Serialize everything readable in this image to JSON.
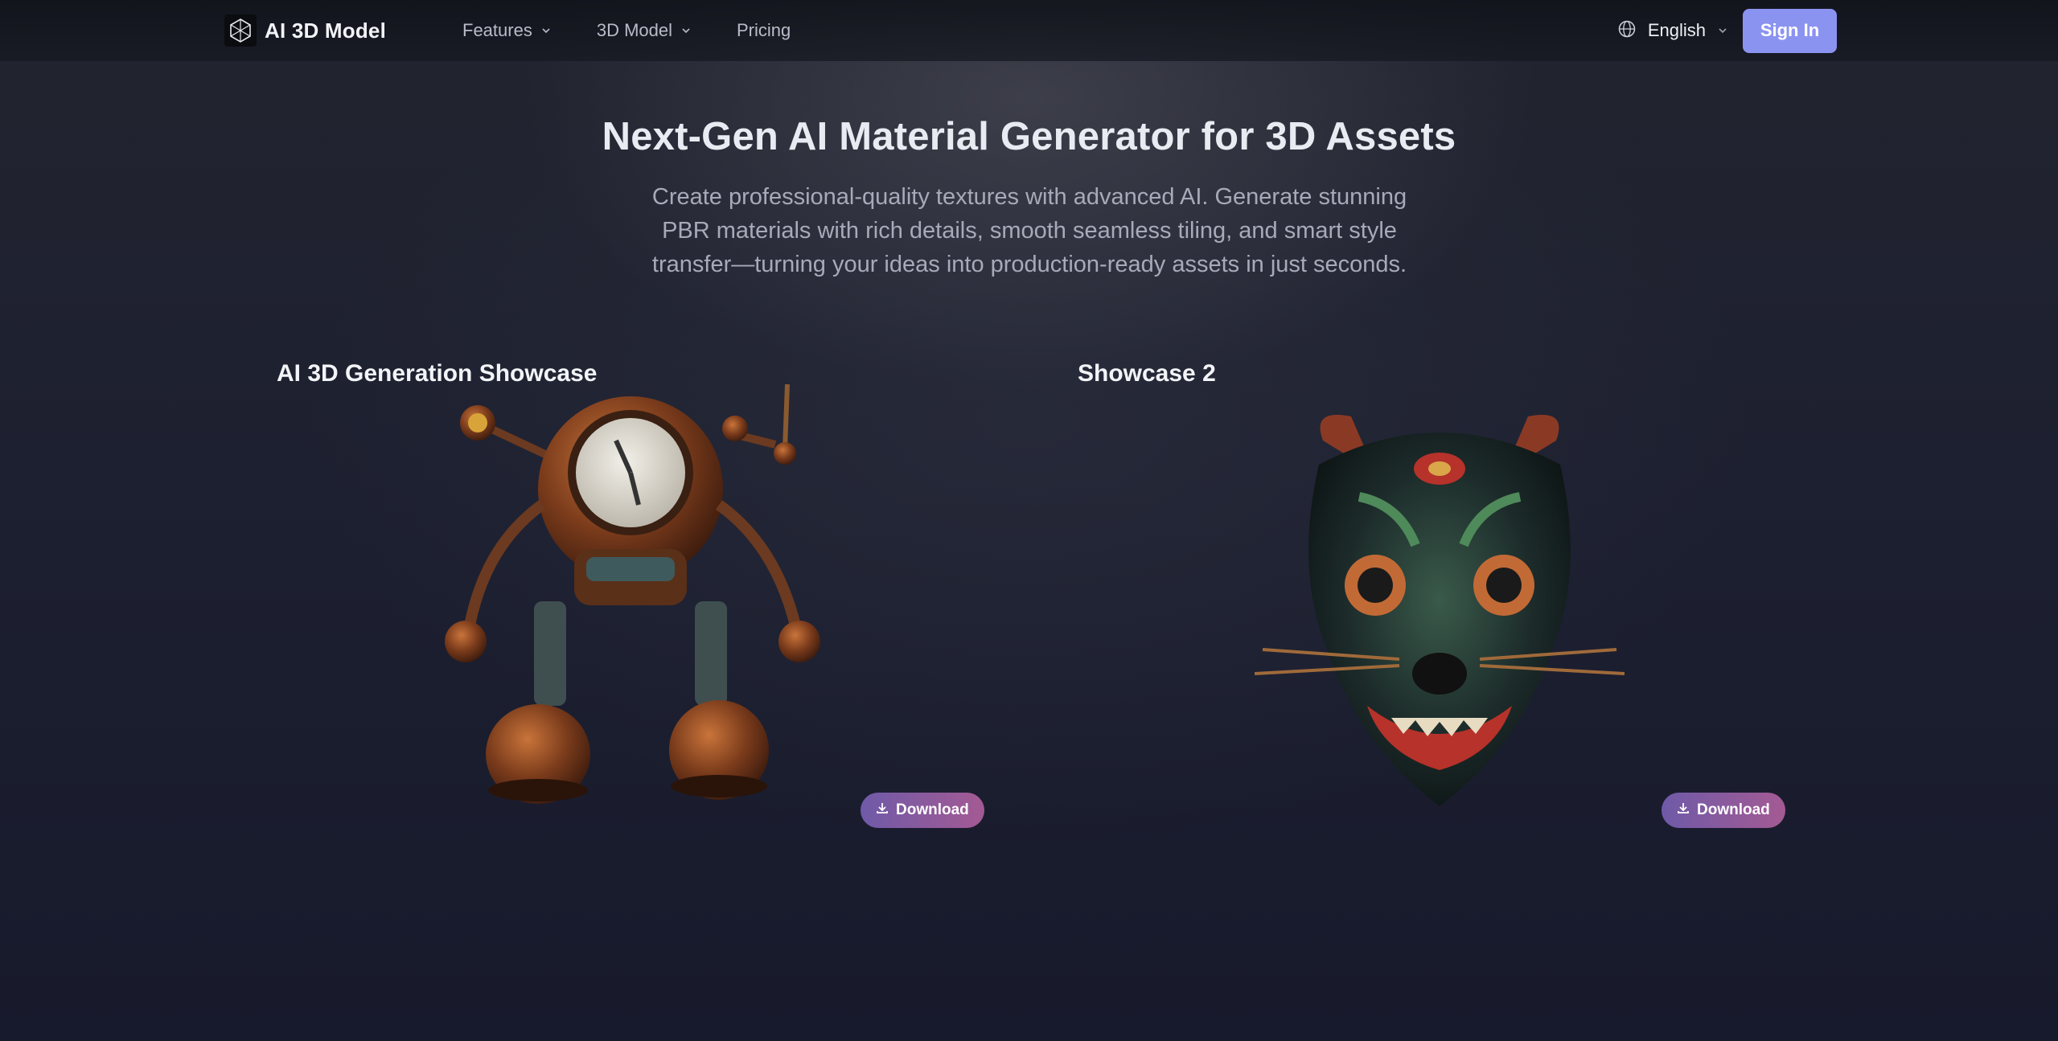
{
  "nav": {
    "logo_text": "AI 3D Model",
    "menu": [
      {
        "label": "Features",
        "has_dropdown": true
      },
      {
        "label": "3D Model",
        "has_dropdown": true
      },
      {
        "label": "Pricing",
        "has_dropdown": false
      }
    ],
    "language": "English",
    "signin_label": "Sign In"
  },
  "hero": {
    "title": "Next-Gen AI Material Generator for 3D Assets",
    "subtitle": "Create professional-quality textures with advanced AI. Generate stunning PBR materials with rich details, smooth seamless tiling, and smart style transfer—turning your ideas into production-ready assets in just seconds."
  },
  "showcases": [
    {
      "title": "AI 3D Generation Showcase",
      "download_label": "Download",
      "model_icon": "clock-robot-model"
    },
    {
      "title": "Showcase 2",
      "download_label": "Download",
      "model_icon": "tiger-mask-model"
    }
  ],
  "colors": {
    "accent": "#8b93f0",
    "download_gradient_start": "#6f5aa8",
    "download_gradient_end": "#a45a93",
    "background": "#171a2a"
  }
}
